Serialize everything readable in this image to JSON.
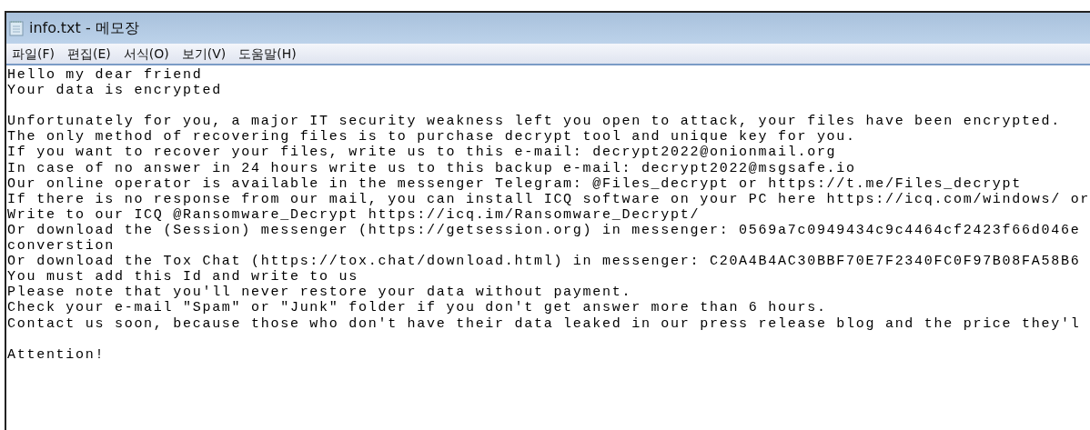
{
  "window": {
    "title": "info.txt - 메모장"
  },
  "menu": [
    "파일(F)",
    "편집(E)",
    "서식(O)",
    "보기(V)",
    "도움말(H)"
  ],
  "paragraphs": [
    [
      "Hello my dear friend",
      "Your data is encrypted"
    ],
    [
      "Unfortunately for you, a major IT security weakness left you open to attack, your files have been encrypted.",
      "The only method of recovering files is to purchase decrypt tool and unique key for you.",
      "If you want to recover your files, write us to this e-mail: decrypt2022@onionmail.org",
      "In case of no answer in 24 hours write us to this backup e-mail: decrypt2022@msgsafe.io",
      "Our online operator is available in the messenger Telegram: @Files_decrypt or https://t.me/Files_decrypt",
      "If there is no response from our mail, you can install ICQ software on your PC here https://icq.com/windows/ or",
      "Write to our ICQ @Ransomware_Decrypt https://icq.im/Ransomware_Decrypt/",
      "Or download the (Session) messenger (https://getsession.org) in messenger: 0569a7c0949434c9c4464cf2423f66d046e",
      "converstion",
      "Or download the Tox Chat (https://tox.chat/download.html) in messenger: C20A4B4AC30BBF70E7F2340FC0F97B08FA58B6",
      "You must add this Id and write to us",
      "Please note that you'll never restore your data without payment.",
      "Check your e-mail \"Spam\" or \"Junk\" folder if you don't get answer more than 6 hours.",
      "Contact us soon, because those who don't have their data leaked in our press release blog and the price they'l"
    ],
    [
      "Attention!"
    ]
  ]
}
